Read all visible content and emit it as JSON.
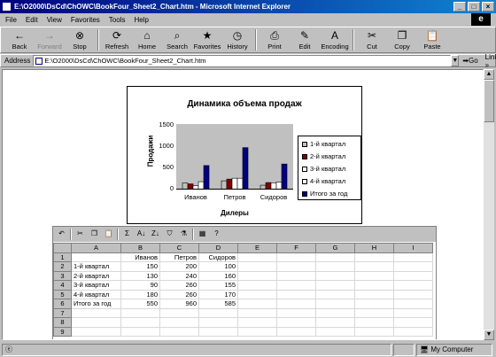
{
  "window": {
    "title": "E:\\O2000\\DsCd\\ChOWC\\BookFour_Sheet2_Chart.htm - Microsoft Internet Explorer",
    "controls": [
      "_",
      "□",
      "×"
    ]
  },
  "menu": [
    "File",
    "Edit",
    "View",
    "Favorites",
    "Tools",
    "Help"
  ],
  "toolbar": [
    {
      "label": "Back",
      "icon": "←",
      "name": "back-button",
      "enabled": true
    },
    {
      "label": "Forward",
      "icon": "→",
      "name": "forward-button",
      "enabled": false
    },
    {
      "label": "Stop",
      "icon": "⊗",
      "name": "stop-button",
      "enabled": true
    },
    {
      "label": "Refresh",
      "icon": "⟳",
      "name": "refresh-button",
      "enabled": true
    },
    {
      "label": "Home",
      "icon": "⌂",
      "name": "home-button",
      "enabled": true
    },
    {
      "label": "Search",
      "icon": "⌕",
      "name": "search-button",
      "enabled": true
    },
    {
      "label": "Favorites",
      "icon": "★",
      "name": "favorites-button",
      "enabled": true
    },
    {
      "label": "History",
      "icon": "◷",
      "name": "history-button",
      "enabled": true
    },
    {
      "label": "Print",
      "icon": "⎙",
      "name": "print-button",
      "enabled": true
    },
    {
      "label": "Edit",
      "icon": "✎",
      "name": "edit-button",
      "enabled": true
    },
    {
      "label": "Encoding",
      "icon": "A",
      "name": "encoding-button",
      "enabled": true
    },
    {
      "label": "Cut",
      "icon": "✂",
      "name": "cut-button",
      "enabled": true
    },
    {
      "label": "Copy",
      "icon": "❐",
      "name": "copy-button",
      "enabled": true
    },
    {
      "label": "Paste",
      "icon": "📋",
      "name": "paste-button",
      "enabled": true
    }
  ],
  "address": {
    "label": "Address",
    "value": "E:\\O2000\\DsCd\\ChOWC\\BookFour_Sheet2_Chart.htm",
    "go": "Go",
    "links": "Links »"
  },
  "chart_data": {
    "type": "bar",
    "title": "Динамика объема продаж",
    "xlabel": "Дилеры",
    "ylabel": "Продажи",
    "categories": [
      "Иванов",
      "Петров",
      "Сидоров"
    ],
    "ylim": [
      0,
      1500
    ],
    "yticks": [
      "1500",
      "1000",
      "500",
      "0"
    ],
    "series": [
      {
        "name": "1-й квартал",
        "values": [
          150,
          200,
          100
        ],
        "color": "#c0c0c0"
      },
      {
        "name": "2-й квартал",
        "values": [
          130,
          240,
          160
        ],
        "color": "#800000"
      },
      {
        "name": "3-й квартал",
        "values": [
          90,
          260,
          155
        ],
        "color": "#ffffff"
      },
      {
        "name": "4-й квартал",
        "values": [
          180,
          260,
          170
        ],
        "color": "#ffffff"
      },
      {
        "name": "Итого за год",
        "values": [
          550,
          960,
          585
        ],
        "color": "#000080"
      }
    ],
    "grid": false,
    "legend": "right"
  },
  "sheet": {
    "columns": [
      "A",
      "B",
      "C",
      "D",
      "E",
      "F",
      "G",
      "H",
      "I"
    ],
    "rows": [
      [
        "",
        "Иванов",
        "Петров",
        "Сидоров",
        "",
        "",
        "",
        "",
        ""
      ],
      [
        "1-й квартал",
        "150",
        "200",
        "100",
        "",
        "",
        "",
        "",
        ""
      ],
      [
        "2-й квартал",
        "130",
        "240",
        "160",
        "",
        "",
        "",
        "",
        ""
      ],
      [
        "3-й квартал",
        "90",
        "260",
        "155",
        "",
        "",
        "",
        "",
        ""
      ],
      [
        "4-й квартал",
        "180",
        "260",
        "170",
        "",
        "",
        "",
        "",
        ""
      ],
      [
        "Итого за год",
        "550",
        "960",
        "585",
        "",
        "",
        "",
        "",
        ""
      ],
      [
        "",
        "",
        "",
        "",
        "",
        "",
        "",
        "",
        ""
      ],
      [
        "",
        "",
        "",
        "",
        "",
        "",
        "",
        "",
        ""
      ],
      [
        "",
        "",
        "",
        "",
        "",
        "",
        "",
        "",
        ""
      ]
    ],
    "row_numbers": [
      "1",
      "2",
      "3",
      "4",
      "5",
      "6",
      "7",
      "8",
      "9"
    ],
    "toolbar_glyphs": [
      "↶",
      "✂",
      "❐",
      "📋",
      "Σ",
      "A↓",
      "Z↓",
      "⛉",
      "⚗",
      "▦",
      "?"
    ]
  },
  "status": {
    "text": "",
    "zone": "My Computer"
  }
}
